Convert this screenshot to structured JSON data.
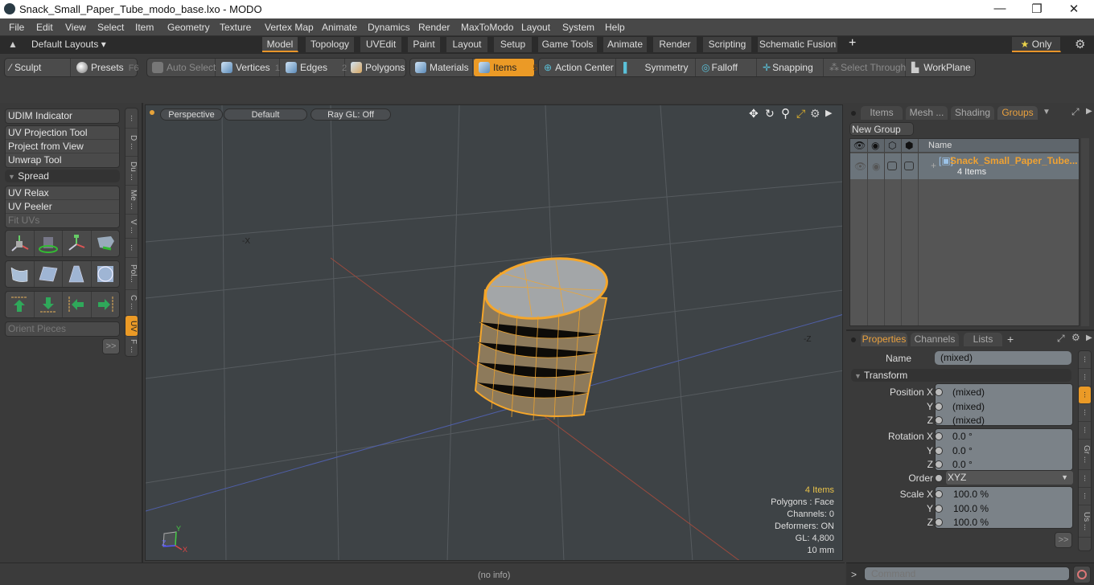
{
  "window": {
    "title": "Snack_Small_Paper_Tube_modo_base.lxo - MODO",
    "minimize": "—",
    "maximize": "❐",
    "close": "✕"
  },
  "menu": [
    "File",
    "Edit",
    "View",
    "Select",
    "Item",
    "Geometry",
    "Texture",
    "Vertex Map",
    "Animate",
    "Dynamics",
    "Render",
    "MaxToModo",
    "Layout",
    "System",
    "Help"
  ],
  "layoutbar": {
    "layouts_label": "Default Layouts ▾",
    "tabs": [
      "Model",
      "Topology",
      "UVEdit",
      "Paint",
      "Layout",
      "Setup",
      "Game Tools",
      "Animate",
      "Render",
      "Scripting",
      "Schematic Fusion"
    ],
    "active_tab": "Model",
    "add": "+",
    "only_label": "Only",
    "accent": "#e8952a"
  },
  "toolbar": {
    "sculpt": "Sculpt",
    "presets": "Presets",
    "presets_key": "F6",
    "auto_select": "Auto Select",
    "vertices": "Vertices",
    "vertices_key": "1",
    "edges": "Edges",
    "edges_key": "2",
    "polygons": "Polygons",
    "materials": "Materials",
    "items": "Items",
    "items_key": "5",
    "action_center": "Action Center",
    "symmetry": "Symmetry",
    "falloff": "Falloff",
    "snapping": "Snapping",
    "select_through": "Select Through",
    "workplane": "WorkPlane"
  },
  "leftpanel": {
    "udim": "UDIM Indicator",
    "tools1": [
      "UV Projection Tool",
      "Project from View",
      "Unwrap Tool"
    ],
    "spread": "Spread",
    "tools2": [
      "UV Relax",
      "UV Peeler",
      "Fit UVs"
    ],
    "orient": "Orient Pieces",
    "more": ">>",
    "vtabs": [
      "...",
      "D ...",
      "Du ...",
      "Me ...",
      "V ...",
      "...",
      "Pol...",
      "C ...",
      "UV",
      "F ..."
    ],
    "active_vtab": "UV"
  },
  "viewport": {
    "view": "Perspective",
    "shading": "Default",
    "raygl": "Ray GL: Off",
    "axis_neg_x": "-X",
    "axis_neg_z": "-Z",
    "stats": {
      "items": "4 Items",
      "polygons": "Polygons : Face",
      "channels": "Channels: 0",
      "deformers": "Deformers: ON",
      "gl": "GL: 4,800",
      "units": "10 mm"
    },
    "gizmo": {
      "x": "X",
      "y": "Y",
      "z": "Z"
    }
  },
  "groups_panel": {
    "tabs": [
      "Items",
      "Mesh ...",
      "Shading",
      "Groups"
    ],
    "active_tab": "Groups",
    "new_group": "New Group",
    "col_name": "Name",
    "row": {
      "name": "Snack_Small_Paper_Tube...",
      "count": "4 Items"
    }
  },
  "properties_panel": {
    "tabs": [
      "Properties",
      "Channels",
      "Lists"
    ],
    "active_tab": "Properties",
    "add": "+",
    "name_label": "Name",
    "name_value": "(mixed)",
    "section": "Transform",
    "position": {
      "label": "Position X",
      "x": "(mixed)",
      "y": "(mixed)",
      "z": "(mixed)"
    },
    "rotation": {
      "label": "Rotation X",
      "x": "0.0 °",
      "y": "0.0 °",
      "z": "0.0 °"
    },
    "order_label": "Order",
    "order_value": "XYZ",
    "scale": {
      "label": "Scale X",
      "x": "100.0 %",
      "y": "100.0 %",
      "z": "100.0 %"
    },
    "axis_y": "Y",
    "axis_z": "Z",
    "more": ">>",
    "vtabs": [
      "...",
      "...",
      "...",
      "...",
      "...",
      "Gr ...",
      "...",
      "...",
      "Us ..."
    ]
  },
  "statusbar": {
    "info": "(no info)"
  },
  "command": {
    "prompt": ">",
    "placeholder": "Command"
  }
}
